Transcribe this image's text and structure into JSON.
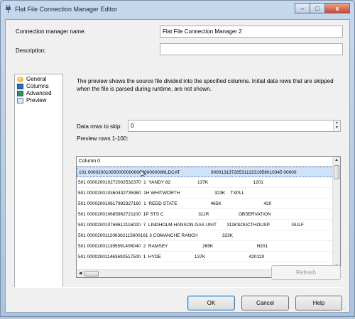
{
  "window": {
    "title": "Flat File Connection Manager Editor",
    "minimize": "–",
    "maximize": "□",
    "close": "x"
  },
  "form": {
    "name_label": "Connection manager name:",
    "name_value": "Flat File Connection Manager 2",
    "description_label": "Description:",
    "description_value": ""
  },
  "nav": {
    "items": [
      {
        "label": "General",
        "icon": "general-icon"
      },
      {
        "label": "Columns",
        "icon": "columns-icon"
      },
      {
        "label": "Advanced",
        "icon": "advanced-icon"
      },
      {
        "label": "Preview",
        "icon": "preview-icon"
      }
    ],
    "selected": "Preview"
  },
  "preview": {
    "description": "The preview shows the source file divided into the specified columns. Initial data rows that are skipped when the file is parsed during runtime, are not shown.",
    "rows_to_skip_label": "Data rows to skip:",
    "rows_to_skip_value": "0",
    "rows_label": "Preview rows 1-100:",
    "column_header": "Column 0",
    "rows": [
      "101 0000200100000000000000000000WILDCAT                        0000131372653113231958010345 00000",
      "501 000020010272002532370  1  YANDY 82                     137K                                   1201",
      "501 000020010360432735980  1H WHITWORTH                           323K    TXPLL",
      "501 000020010617992327160  1  REDD STATE                          465K                                 420",
      "501 000020010685962721100  1P STS C                           311R                       OBSERVATION",
      "501 000020010768612116020  7  LINDHOLM-HANSON GAS UNIT        311KSOUCTHOUSP                 GULF",
      "501 000020011206362115600161 3 COMANCHE RANCH                   323K",
      "501 000020011395591406040  2  RAMSEY                           265K                                  H201",
      "501 000020011463692517500  1  HYDE                          137K                                  420120"
    ]
  },
  "buttons": {
    "refresh": "Refresh",
    "ok": "OK",
    "cancel": "Cancel",
    "help": "Help"
  }
}
